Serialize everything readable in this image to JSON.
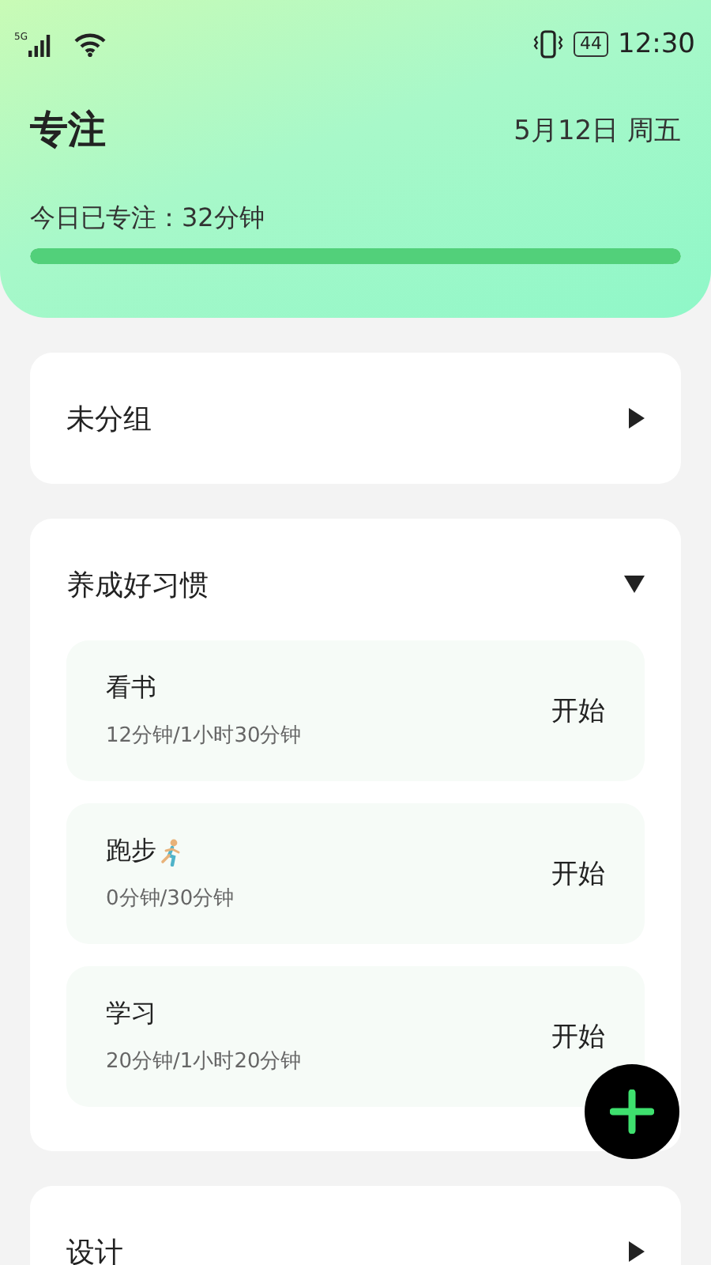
{
  "status_bar": {
    "network": "5G",
    "battery": "44",
    "time": "12:30"
  },
  "header": {
    "title": "专注",
    "date": "5月12日 周五",
    "today_label": "今日已专注：32分钟",
    "progress": {
      "level": 1
    }
  },
  "groups": [
    {
      "name": "未分组",
      "expanded": false
    },
    {
      "name": "养成好习惯",
      "expanded": true,
      "tasks": [
        {
          "name": "看书",
          "kind": "plain",
          "progress": "12分钟/1小时30分钟",
          "action": "开始"
        },
        {
          "name": "跑步",
          "kind": "runner",
          "progress": "0分钟/30分钟",
          "action": "开始"
        },
        {
          "name": "学习",
          "kind": "plain",
          "progress": "20分钟/1小时20分钟",
          "action": "开始"
        }
      ]
    },
    {
      "name": "设计",
      "expanded": false
    }
  ]
}
